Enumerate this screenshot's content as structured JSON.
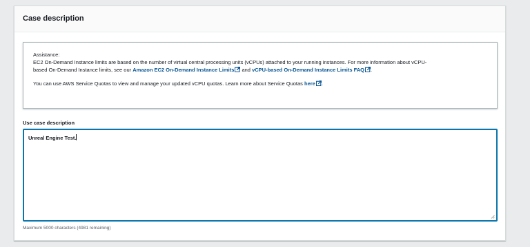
{
  "panel": {
    "title": "Case description"
  },
  "assistance": {
    "heading": "Assistance:",
    "line1": "EC2 On-Demand Instance limits are based on the number of virtual central processing units (vCPUs) attached to your running instances. For more information about vCPU-",
    "line2_prefix": "based On-Demand Instance limits, see our ",
    "link1": "Amazon EC2 On-Demand Instance Limits",
    "and_text": " and ",
    "link2": "vCPU-based On-Demand Instance Limits FAQ",
    "line2_suffix": ".",
    "quotas_prefix": "You can use AWS Service Quotas to view and manage your updated vCPU quotas. Learn more about Service Quotas ",
    "link3": "here",
    "quotas_suffix": "."
  },
  "use_case": {
    "label": "Use case description",
    "value": "Unreal Engine Test.",
    "hint": "Maximum 5000 characters (4981 remaining)"
  },
  "colors": {
    "link": "#0a5694",
    "focus_border": "#0a75ad",
    "page_background": "#e9ebed"
  },
  "icons": [
    "external-link-icon",
    "resize-grip-icon"
  ]
}
